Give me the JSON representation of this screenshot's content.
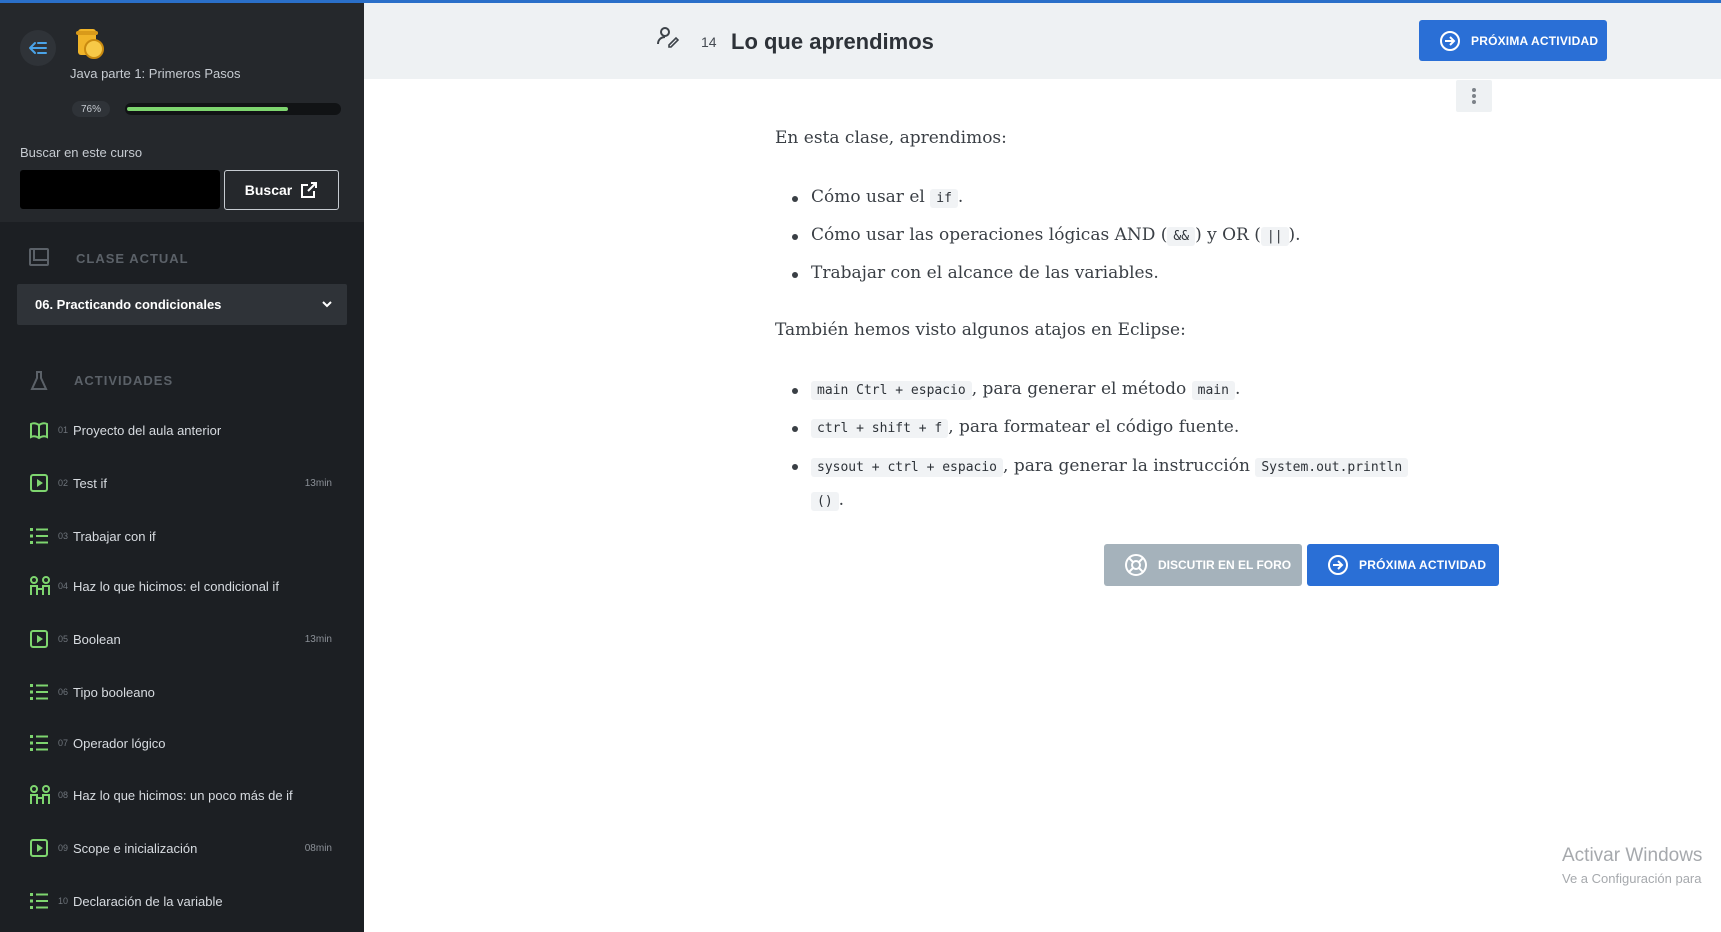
{
  "sidebar": {
    "course_title": "Java parte 1: Primeros Pasos",
    "progress_label": "76%",
    "progress_fraction": 0.76,
    "search_label": "Buscar en este curso",
    "search_value": "",
    "search_button": "Buscar",
    "current_section_title": "CLASE ACTUAL",
    "current_lesson": "06. Practicando condicionales",
    "activities_title": "ACTIVIDADES",
    "activities": [
      {
        "num": "01",
        "label": "Proyecto del aula anterior",
        "duration": "",
        "icon": "book-icon"
      },
      {
        "num": "02",
        "label": "Test if",
        "duration": "13min",
        "icon": "video-play-icon"
      },
      {
        "num": "03",
        "label": "Trabajar con if",
        "duration": "",
        "icon": "list-icon"
      },
      {
        "num": "04",
        "label": "Haz lo que hicimos: el condicional if",
        "duration": "",
        "icon": "people-icon"
      },
      {
        "num": "05",
        "label": "Boolean",
        "duration": "13min",
        "icon": "video-play-icon"
      },
      {
        "num": "06",
        "label": "Tipo booleano",
        "duration": "",
        "icon": "list-icon"
      },
      {
        "num": "07",
        "label": "Operador lógico",
        "duration": "",
        "icon": "list-icon"
      },
      {
        "num": "08",
        "label": "Haz lo que hicimos: un poco más de if",
        "duration": "",
        "icon": "people-icon"
      },
      {
        "num": "09",
        "label": "Scope e inicialización",
        "duration": "08min",
        "icon": "video-play-icon"
      },
      {
        "num": "10",
        "label": "Declaración de la variable",
        "duration": "",
        "icon": "list-icon"
      }
    ]
  },
  "header": {
    "number": "14",
    "title": "Lo que aprendimos",
    "next_button": "PRÓXIMA ACTIVIDAD"
  },
  "content": {
    "intro": "En esta clase, aprendimos:",
    "list1": {
      "a_pre": "Cómo usar el ",
      "a_code": "if",
      "a_post": ".",
      "b_pre": "Cómo usar las operaciones lógicas AND (",
      "b_code1": "&&",
      "b_mid": ") y OR (",
      "b_code2": "||",
      "b_post": ").",
      "c": "Trabajar con el alcance de las variables."
    },
    "shortcuts_intro": "También hemos visto algunos atajos en Eclipse:",
    "list2": {
      "a_code1": "main Ctrl + espacio",
      "a_mid": ", para generar el método ",
      "a_code2": "main",
      "a_post": ".",
      "b_code": "ctrl + shift + f",
      "b_post": ", para formatear el código fuente.",
      "c_code1": "sysout + ctrl + espacio",
      "c_mid": ", para generar la instrucción ",
      "c_code2": "System.out.println",
      "c_code3": "()",
      "c_post": "."
    }
  },
  "footer_buttons": {
    "forum": "DISCUTIR EN EL FORO",
    "next": "PRÓXIMA ACTIVIDAD"
  },
  "watermark": {
    "line1": "Activar Windows",
    "line2": "Ve a Configuración para"
  },
  "colors": {
    "accent": "#2a6fd6",
    "progress": "#7ed56f",
    "icon_green": "#7ed56f",
    "sidebar_bg": "#1c1f23"
  }
}
